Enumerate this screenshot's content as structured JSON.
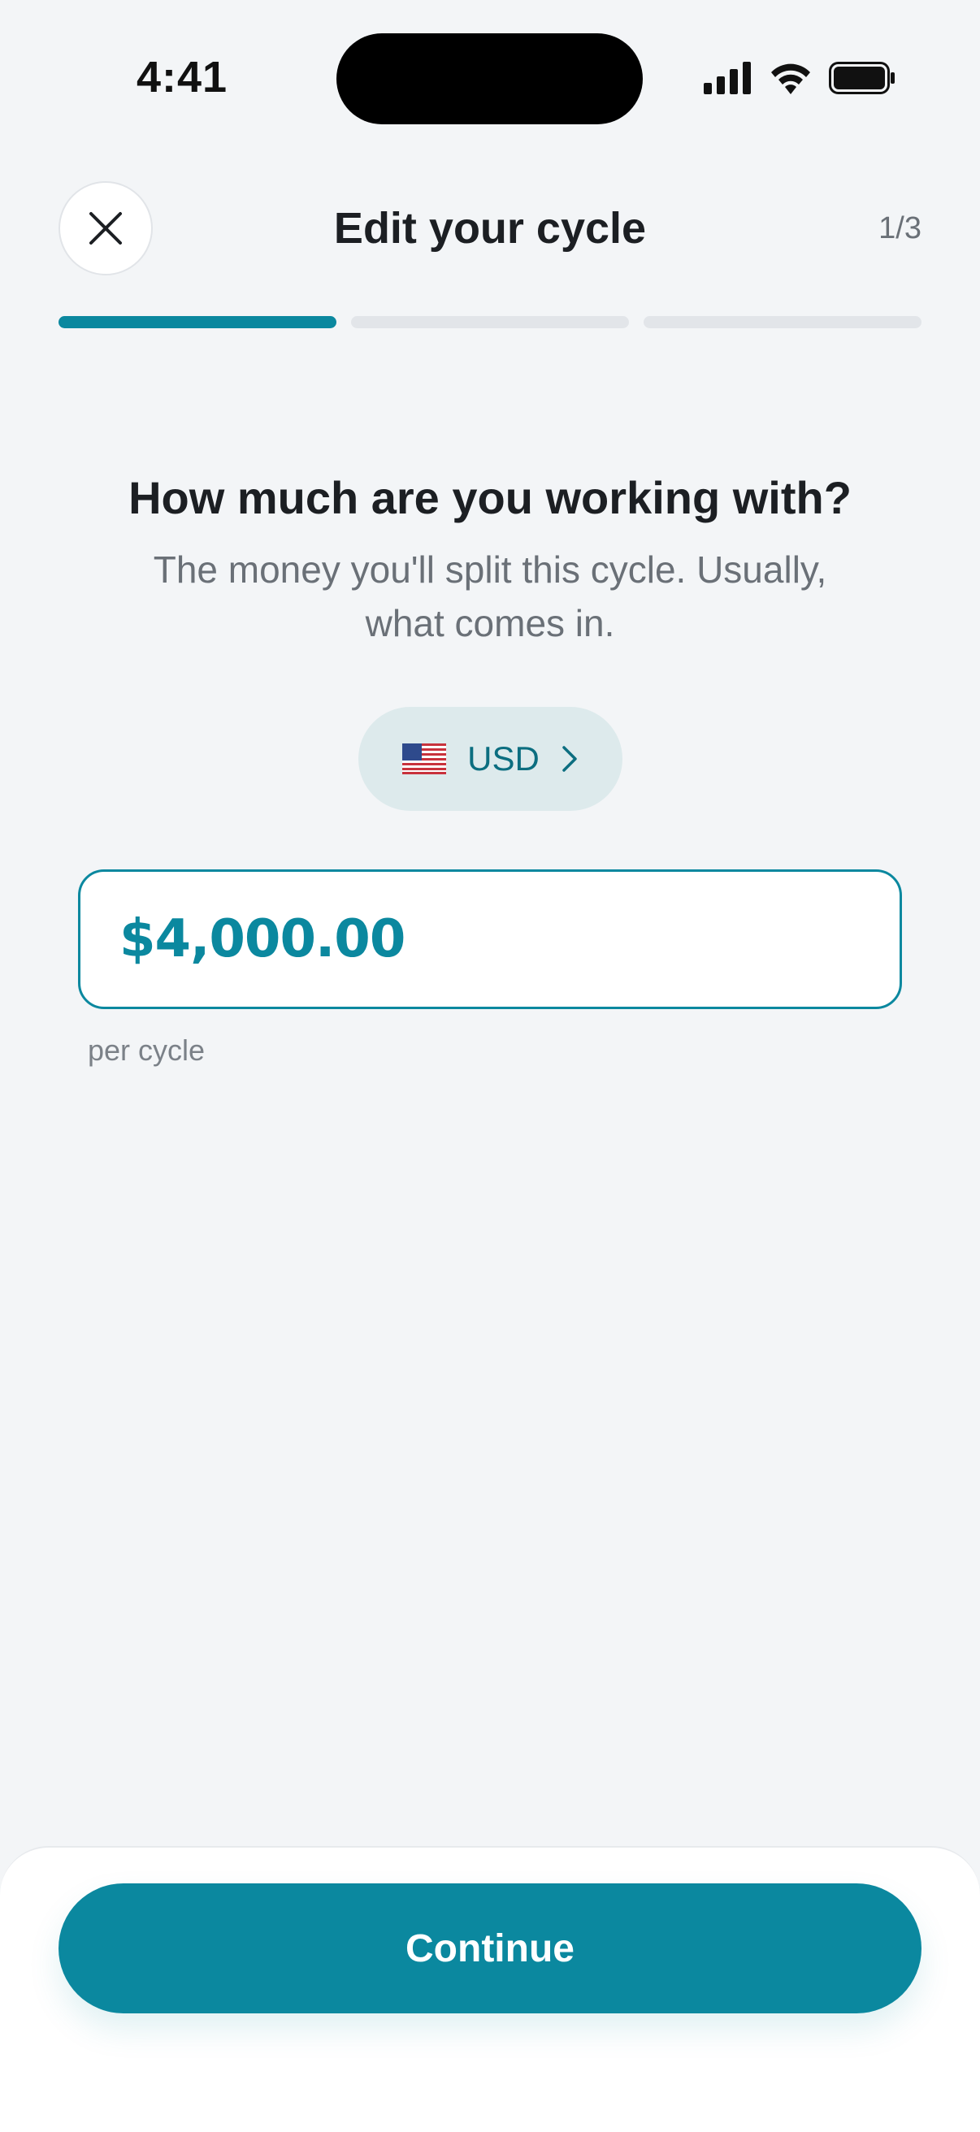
{
  "status_bar": {
    "time": "4:41"
  },
  "header": {
    "title": "Edit your cycle",
    "step": "1/3",
    "close_icon": "close-icon"
  },
  "progress": {
    "total_steps": 3,
    "current_step": 1
  },
  "content": {
    "question": "How much are you working with?",
    "subtitle": "The money you'll split this cycle. Usually, what comes in."
  },
  "currency": {
    "flag_icon": "us-flag-icon",
    "code": "USD",
    "chevron_icon": "chevron-right-icon"
  },
  "amount": {
    "value": "$4,000.00",
    "caption": "per cycle"
  },
  "footer": {
    "continue_label": "Continue"
  },
  "colors": {
    "accent": "#0B889F",
    "background": "#F3F5F7",
    "pill_background": "#DDEAEC",
    "text_primary": "#1C1F23",
    "text_secondary": "#6A7077"
  }
}
